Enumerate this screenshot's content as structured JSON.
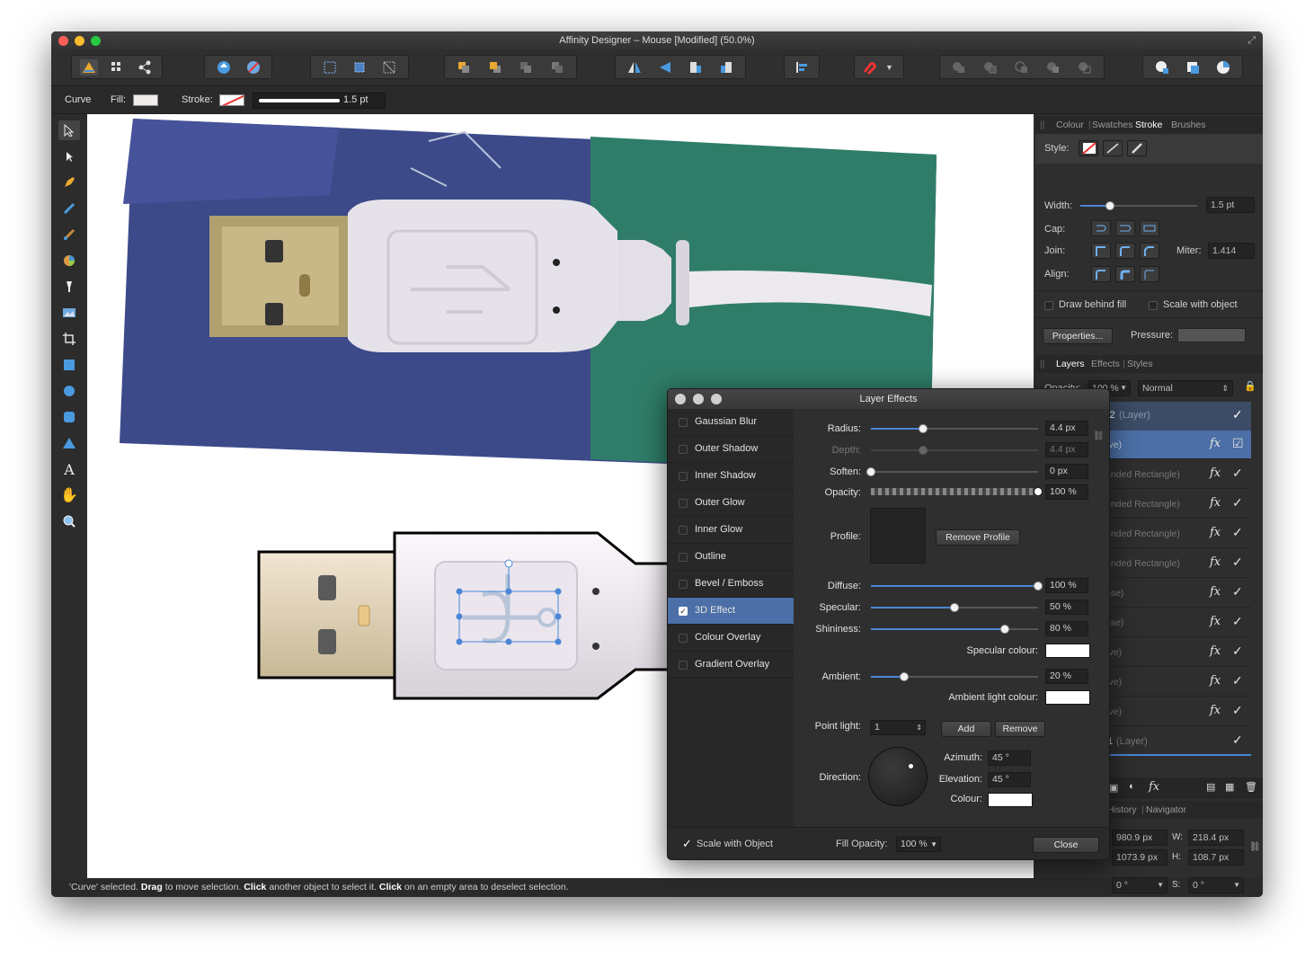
{
  "window": {
    "title": "Affinity Designer – Mouse [Modified] (50.0%)"
  },
  "context_bar": {
    "object": "Curve",
    "fill_label": "Fill:",
    "stroke_label": "Stroke:",
    "stroke_width": "1.5 pt"
  },
  "status_bar": {
    "parts": [
      {
        "text": "'Curve' selected. ",
        "bold": false
      },
      {
        "text": "Drag",
        "bold": true
      },
      {
        "text": " to move selection. ",
        "bold": false
      },
      {
        "text": "Click",
        "bold": true
      },
      {
        "text": " another object to select it. ",
        "bold": false
      },
      {
        "text": "Click",
        "bold": true
      },
      {
        "text": " on an empty area to deselect selection.",
        "bold": false
      }
    ]
  },
  "stroke_panel": {
    "tabs": [
      "Colour",
      "Swatches",
      "Stroke",
      "Brushes"
    ],
    "active_tab": "Stroke",
    "style_label": "Style:",
    "width_label": "Width:",
    "width_value": "1.5 pt",
    "cap_label": "Cap:",
    "join_label": "Join:",
    "miter_label": "Miter:",
    "miter_value": "1.414",
    "align_label": "Align:",
    "draw_behind_fill": "Draw behind fill",
    "scale_with_object": "Scale with object",
    "properties_button": "Properties...",
    "pressure_label": "Pressure:"
  },
  "layers_panel": {
    "tabs": [
      "Layers",
      "Effects",
      "Styles"
    ],
    "active_tab": "Layers",
    "opacity_label": "Opacity:",
    "opacity_value": "100 %",
    "blend_mode": "Normal",
    "top_layer": {
      "name": "Layer2",
      "kind": "(Layer)"
    },
    "rows": [
      {
        "name": "rve)",
        "fx": "fx",
        "selected": true
      },
      {
        "name": "unded Rectangle)",
        "fx": "fx",
        "selected": false
      },
      {
        "name": "unded Rectangle)",
        "fx": "fx",
        "selected": false
      },
      {
        "name": "unded Rectangle)",
        "fx": "fx",
        "selected": false
      },
      {
        "name": "unded Rectangle)",
        "fx": "fx",
        "selected": false
      },
      {
        "name": "pse)",
        "fx": "fx",
        "selected": false
      },
      {
        "name": "pse)",
        "fx": "fx",
        "selected": false
      },
      {
        "name": "rve)",
        "fx": "fx",
        "selected": false
      },
      {
        "name": "rve)",
        "fx": "fx",
        "selected": false
      },
      {
        "name": "rve)",
        "fx": "fx",
        "selected": false
      }
    ],
    "bottom_layer": {
      "name": "1",
      "kind": "(Layer)"
    },
    "footer_fx": "fx"
  },
  "transform_panel": {
    "tabs": [
      "History",
      "Navigator"
    ],
    "x": "980.9 px",
    "y": "1073.9 px",
    "w_label": "W:",
    "w": "218.4 px",
    "h_label": "H:",
    "h": "108.7 px",
    "r": "0 °",
    "s_label": "S:",
    "s": "0 °"
  },
  "layer_effects": {
    "title": "Layer Effects",
    "effects": [
      {
        "name": "Gaussian Blur",
        "checked": false
      },
      {
        "name": "Outer Shadow",
        "checked": false
      },
      {
        "name": "Inner Shadow",
        "checked": false
      },
      {
        "name": "Outer Glow",
        "checked": false
      },
      {
        "name": "Inner Glow",
        "checked": false
      },
      {
        "name": "Outline",
        "checked": false
      },
      {
        "name": "Bevel / Emboss",
        "checked": false
      },
      {
        "name": "3D Effect",
        "checked": true
      },
      {
        "name": "Colour Overlay",
        "checked": false
      },
      {
        "name": "Gradient Overlay",
        "checked": false
      }
    ],
    "radius": {
      "label": "Radius:",
      "value": "4.4 px",
      "level": 0.31
    },
    "depth": {
      "label": "Depth:",
      "value": "4.4 px",
      "level": 0.31
    },
    "soften": {
      "label": "Soften:",
      "value": "0 px",
      "level": 0.0
    },
    "opacity": {
      "label": "Opacity:",
      "value": "100 %",
      "level": 1.0
    },
    "profile_label": "Profile:",
    "remove_profile": "Remove Profile",
    "diffuse": {
      "label": "Diffuse:",
      "value": "100 %",
      "level": 1.0
    },
    "specular": {
      "label": "Specular:",
      "value": "50 %",
      "level": 0.5
    },
    "shininess": {
      "label": "Shininess:",
      "value": "80 %",
      "level": 0.8
    },
    "specular_colour_label": "Specular colour:",
    "ambient": {
      "label": "Ambient:",
      "value": "20 %",
      "level": 0.2
    },
    "ambient_colour_label": "Ambient light colour:",
    "point_light_label": "Point light:",
    "point_light_value": "1",
    "add_button": "Add",
    "remove_button": "Remove",
    "direction_label": "Direction:",
    "azimuth_label": "Azimuth:",
    "azimuth_value": "45 °",
    "elevation_label": "Elevation:",
    "elevation_value": "45 °",
    "colour_label": "Colour:",
    "scale_with_object": "Scale with Object",
    "fill_opacity_label": "Fill Opacity:",
    "fill_opacity_value": "100 %",
    "close_button": "Close"
  }
}
